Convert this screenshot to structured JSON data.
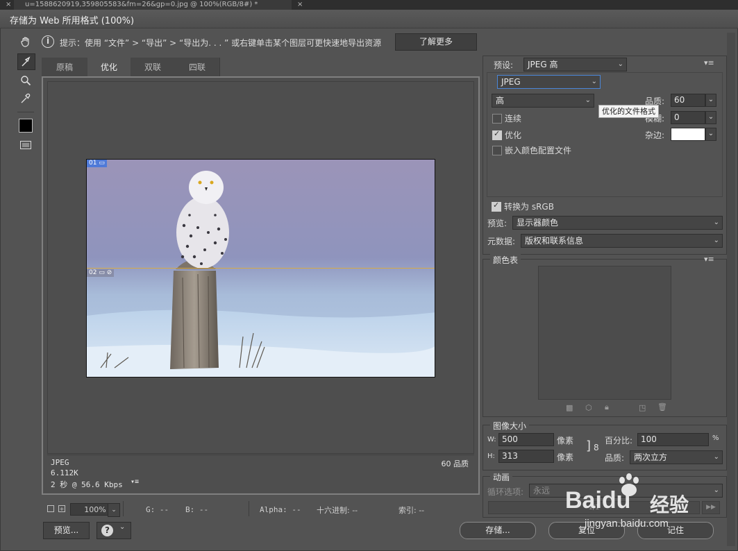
{
  "doc_tab": {
    "close_glyph": "×",
    "title": "u=1588620919,359805583&fm=26&gp=0.jpg @ 100%(RGB/8#) *"
  },
  "dialog": {
    "title": "存储为 Web 所用格式 (100%)"
  },
  "infobar": {
    "tip": "提示：使用 “文件” > “导出” > “导出为. . . ” 或右键单击某个图层可更快速地导出资源",
    "learn_more": "了解更多"
  },
  "view_tabs": [
    "原稿",
    "优化",
    "双联",
    "四联"
  ],
  "slices": [
    "01",
    "02"
  ],
  "image_info": {
    "format": "JPEG",
    "size": "6.112K",
    "time": "2 秒 @ 56.6 Kbps",
    "quality": "60 品质"
  },
  "status": {
    "zoom": "100%",
    "g": "G: --",
    "b": "B: --",
    "alpha": "Alpha: --",
    "hex": "十六进制: --",
    "index": "索引: --"
  },
  "buttons": {
    "preview": "预览...",
    "save": "存储...",
    "reset": "复位",
    "remember": "记住"
  },
  "preset": {
    "label": "预设:",
    "value": "JPEG 高"
  },
  "format": {
    "value": "JPEG"
  },
  "quality_level": {
    "value": "高"
  },
  "quality": {
    "label": "品质:",
    "value": "60"
  },
  "blur": {
    "label": "模糊:",
    "value": "0"
  },
  "matte": {
    "label": "杂边:",
    "color": "#ffffff"
  },
  "options": {
    "progressive": "连续",
    "optimized": "优化",
    "embed_profile": "嵌入颜色配置文件"
  },
  "tooltip": "优化的文件格式",
  "convert_srgb": "转换为 sRGB",
  "preview_mode": {
    "label": "预览:",
    "value": "显示器颜色"
  },
  "metadata": {
    "label": "元数据:",
    "value": "版权和联系信息"
  },
  "color_table": {
    "title": "颜色表"
  },
  "image_size": {
    "title": "图像大小",
    "w_label": "W:",
    "w": "500",
    "h_label": "H:",
    "h": "313",
    "unit": "像素",
    "percent_label": "百分比:",
    "percent": "100",
    "percent_unit": "%",
    "quality_label": "品质:",
    "resample": "两次立方"
  },
  "animation": {
    "title": "动画",
    "loop_label": "循环选项:",
    "loop_value": "永远",
    "frame": "1/1"
  },
  "watermark": {
    "brand": "Baidu",
    "text": "经验",
    "url": "jingyan.baidu.com"
  }
}
